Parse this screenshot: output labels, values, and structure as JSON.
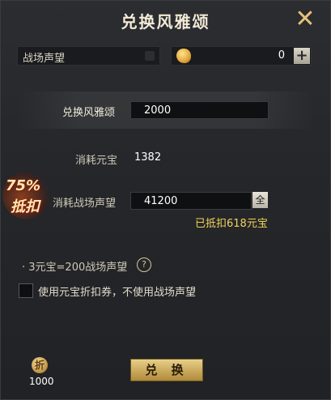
{
  "window": {
    "title": "兑换风雅颂"
  },
  "currency_bar": {
    "reputation_label": "战场声望",
    "yuanbao_value": "0",
    "add_label": "+"
  },
  "exchange": {
    "label": "兑换风雅颂",
    "value": "2000"
  },
  "cost_yuanbao": {
    "label": "消耗元宝",
    "value": "1382"
  },
  "cost_reputation": {
    "label": "消耗战场声望",
    "value": "41200",
    "all_label": "全",
    "deduct_note": "已抵扣618元宝"
  },
  "discount_badge": {
    "percent": "75%",
    "label": "抵扣"
  },
  "rate_text": "· 3元宝=200战场声望",
  "help_label": "?",
  "coupon_option": {
    "label": "使用元宝折扣券，不使用战场声望",
    "checked": false
  },
  "coupon": {
    "icon_text": "折",
    "count": "1000"
  },
  "actions": {
    "exchange_button": "兑 换",
    "close": "✕"
  },
  "colors": {
    "accent_gold": "#e7c27a",
    "deduct_yellow": "#f3d45c",
    "button_gold": "#d6b56a"
  },
  "icons": [
    "close-icon",
    "coin-icon",
    "plus-icon",
    "help-icon",
    "coupon-icon"
  ]
}
